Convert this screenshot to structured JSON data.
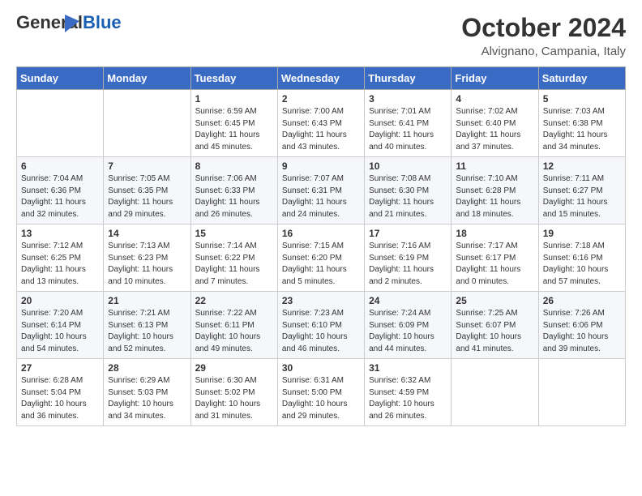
{
  "logo": {
    "general": "General",
    "blue": "Blue"
  },
  "header": {
    "month": "October 2024",
    "location": "Alvignano, Campania, Italy"
  },
  "weekdays": [
    "Sunday",
    "Monday",
    "Tuesday",
    "Wednesday",
    "Thursday",
    "Friday",
    "Saturday"
  ],
  "weeks": [
    [
      {
        "day": "",
        "sunrise": "",
        "sunset": "",
        "daylight": ""
      },
      {
        "day": "",
        "sunrise": "",
        "sunset": "",
        "daylight": ""
      },
      {
        "day": "1",
        "sunrise": "Sunrise: 6:59 AM",
        "sunset": "Sunset: 6:45 PM",
        "daylight": "Daylight: 11 hours and 45 minutes."
      },
      {
        "day": "2",
        "sunrise": "Sunrise: 7:00 AM",
        "sunset": "Sunset: 6:43 PM",
        "daylight": "Daylight: 11 hours and 43 minutes."
      },
      {
        "day": "3",
        "sunrise": "Sunrise: 7:01 AM",
        "sunset": "Sunset: 6:41 PM",
        "daylight": "Daylight: 11 hours and 40 minutes."
      },
      {
        "day": "4",
        "sunrise": "Sunrise: 7:02 AM",
        "sunset": "Sunset: 6:40 PM",
        "daylight": "Daylight: 11 hours and 37 minutes."
      },
      {
        "day": "5",
        "sunrise": "Sunrise: 7:03 AM",
        "sunset": "Sunset: 6:38 PM",
        "daylight": "Daylight: 11 hours and 34 minutes."
      }
    ],
    [
      {
        "day": "6",
        "sunrise": "Sunrise: 7:04 AM",
        "sunset": "Sunset: 6:36 PM",
        "daylight": "Daylight: 11 hours and 32 minutes."
      },
      {
        "day": "7",
        "sunrise": "Sunrise: 7:05 AM",
        "sunset": "Sunset: 6:35 PM",
        "daylight": "Daylight: 11 hours and 29 minutes."
      },
      {
        "day": "8",
        "sunrise": "Sunrise: 7:06 AM",
        "sunset": "Sunset: 6:33 PM",
        "daylight": "Daylight: 11 hours and 26 minutes."
      },
      {
        "day": "9",
        "sunrise": "Sunrise: 7:07 AM",
        "sunset": "Sunset: 6:31 PM",
        "daylight": "Daylight: 11 hours and 24 minutes."
      },
      {
        "day": "10",
        "sunrise": "Sunrise: 7:08 AM",
        "sunset": "Sunset: 6:30 PM",
        "daylight": "Daylight: 11 hours and 21 minutes."
      },
      {
        "day": "11",
        "sunrise": "Sunrise: 7:10 AM",
        "sunset": "Sunset: 6:28 PM",
        "daylight": "Daylight: 11 hours and 18 minutes."
      },
      {
        "day": "12",
        "sunrise": "Sunrise: 7:11 AM",
        "sunset": "Sunset: 6:27 PM",
        "daylight": "Daylight: 11 hours and 15 minutes."
      }
    ],
    [
      {
        "day": "13",
        "sunrise": "Sunrise: 7:12 AM",
        "sunset": "Sunset: 6:25 PM",
        "daylight": "Daylight: 11 hours and 13 minutes."
      },
      {
        "day": "14",
        "sunrise": "Sunrise: 7:13 AM",
        "sunset": "Sunset: 6:23 PM",
        "daylight": "Daylight: 11 hours and 10 minutes."
      },
      {
        "day": "15",
        "sunrise": "Sunrise: 7:14 AM",
        "sunset": "Sunset: 6:22 PM",
        "daylight": "Daylight: 11 hours and 7 minutes."
      },
      {
        "day": "16",
        "sunrise": "Sunrise: 7:15 AM",
        "sunset": "Sunset: 6:20 PM",
        "daylight": "Daylight: 11 hours and 5 minutes."
      },
      {
        "day": "17",
        "sunrise": "Sunrise: 7:16 AM",
        "sunset": "Sunset: 6:19 PM",
        "daylight": "Daylight: 11 hours and 2 minutes."
      },
      {
        "day": "18",
        "sunrise": "Sunrise: 7:17 AM",
        "sunset": "Sunset: 6:17 PM",
        "daylight": "Daylight: 11 hours and 0 minutes."
      },
      {
        "day": "19",
        "sunrise": "Sunrise: 7:18 AM",
        "sunset": "Sunset: 6:16 PM",
        "daylight": "Daylight: 10 hours and 57 minutes."
      }
    ],
    [
      {
        "day": "20",
        "sunrise": "Sunrise: 7:20 AM",
        "sunset": "Sunset: 6:14 PM",
        "daylight": "Daylight: 10 hours and 54 minutes."
      },
      {
        "day": "21",
        "sunrise": "Sunrise: 7:21 AM",
        "sunset": "Sunset: 6:13 PM",
        "daylight": "Daylight: 10 hours and 52 minutes."
      },
      {
        "day": "22",
        "sunrise": "Sunrise: 7:22 AM",
        "sunset": "Sunset: 6:11 PM",
        "daylight": "Daylight: 10 hours and 49 minutes."
      },
      {
        "day": "23",
        "sunrise": "Sunrise: 7:23 AM",
        "sunset": "Sunset: 6:10 PM",
        "daylight": "Daylight: 10 hours and 46 minutes."
      },
      {
        "day": "24",
        "sunrise": "Sunrise: 7:24 AM",
        "sunset": "Sunset: 6:09 PM",
        "daylight": "Daylight: 10 hours and 44 minutes."
      },
      {
        "day": "25",
        "sunrise": "Sunrise: 7:25 AM",
        "sunset": "Sunset: 6:07 PM",
        "daylight": "Daylight: 10 hours and 41 minutes."
      },
      {
        "day": "26",
        "sunrise": "Sunrise: 7:26 AM",
        "sunset": "Sunset: 6:06 PM",
        "daylight": "Daylight: 10 hours and 39 minutes."
      }
    ],
    [
      {
        "day": "27",
        "sunrise": "Sunrise: 6:28 AM",
        "sunset": "Sunset: 5:04 PM",
        "daylight": "Daylight: 10 hours and 36 minutes."
      },
      {
        "day": "28",
        "sunrise": "Sunrise: 6:29 AM",
        "sunset": "Sunset: 5:03 PM",
        "daylight": "Daylight: 10 hours and 34 minutes."
      },
      {
        "day": "29",
        "sunrise": "Sunrise: 6:30 AM",
        "sunset": "Sunset: 5:02 PM",
        "daylight": "Daylight: 10 hours and 31 minutes."
      },
      {
        "day": "30",
        "sunrise": "Sunrise: 6:31 AM",
        "sunset": "Sunset: 5:00 PM",
        "daylight": "Daylight: 10 hours and 29 minutes."
      },
      {
        "day": "31",
        "sunrise": "Sunrise: 6:32 AM",
        "sunset": "Sunset: 4:59 PM",
        "daylight": "Daylight: 10 hours and 26 minutes."
      },
      {
        "day": "",
        "sunrise": "",
        "sunset": "",
        "daylight": ""
      },
      {
        "day": "",
        "sunrise": "",
        "sunset": "",
        "daylight": ""
      }
    ]
  ]
}
